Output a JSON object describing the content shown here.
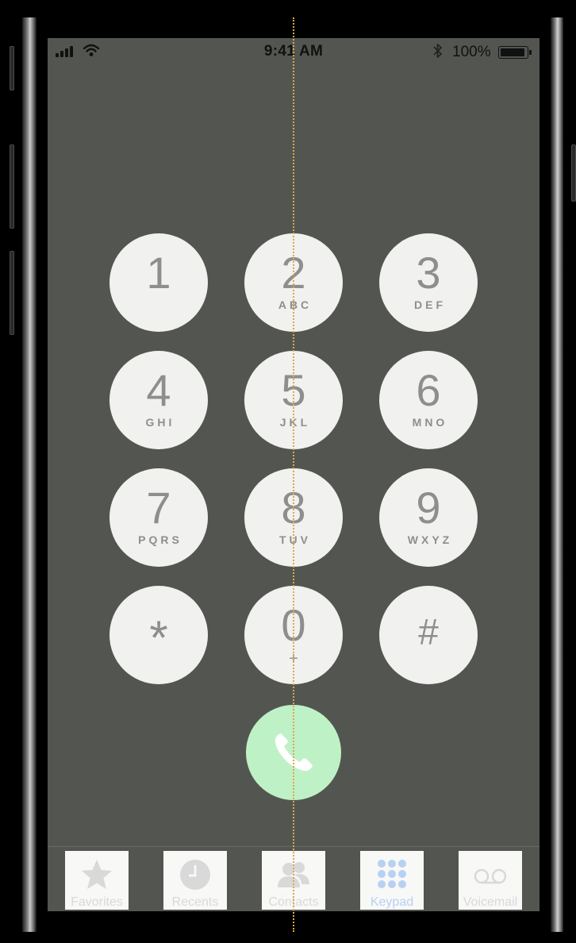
{
  "status_bar": {
    "time": "9:41 AM",
    "battery_percent": "100%",
    "battery_level": 1.0,
    "icons": [
      "signal-icon",
      "wifi-icon",
      "bluetooth-icon",
      "battery-icon"
    ]
  },
  "keypad": {
    "keys": [
      {
        "digit": "1",
        "letters": ""
      },
      {
        "digit": "2",
        "letters": "ABC"
      },
      {
        "digit": "3",
        "letters": "DEF"
      },
      {
        "digit": "4",
        "letters": "GHI"
      },
      {
        "digit": "5",
        "letters": "JKL"
      },
      {
        "digit": "6",
        "letters": "MNO"
      },
      {
        "digit": "7",
        "letters": "PQRS"
      },
      {
        "digit": "8",
        "letters": "TUV"
      },
      {
        "digit": "9",
        "letters": "WXYZ"
      },
      {
        "digit": "*",
        "letters": ""
      },
      {
        "digit": "0",
        "letters": "+"
      },
      {
        "digit": "#",
        "letters": ""
      }
    ],
    "call_icon": "phone-icon"
  },
  "tabbar": {
    "tabs": [
      {
        "label": "Favorites",
        "icon": "star-icon"
      },
      {
        "label": "Recents",
        "icon": "clock-icon"
      },
      {
        "label": "Contacts",
        "icon": "contacts-icon"
      },
      {
        "label": "Keypad",
        "icon": "keypad-icon",
        "active": true
      },
      {
        "label": "Voicemail",
        "icon": "voicemail-icon"
      }
    ]
  },
  "colors": {
    "screen_bg": "#535650",
    "key_bg": "#f1f2ef",
    "call_button": "#bff1c6",
    "active_tab": "#b7d1f3"
  }
}
